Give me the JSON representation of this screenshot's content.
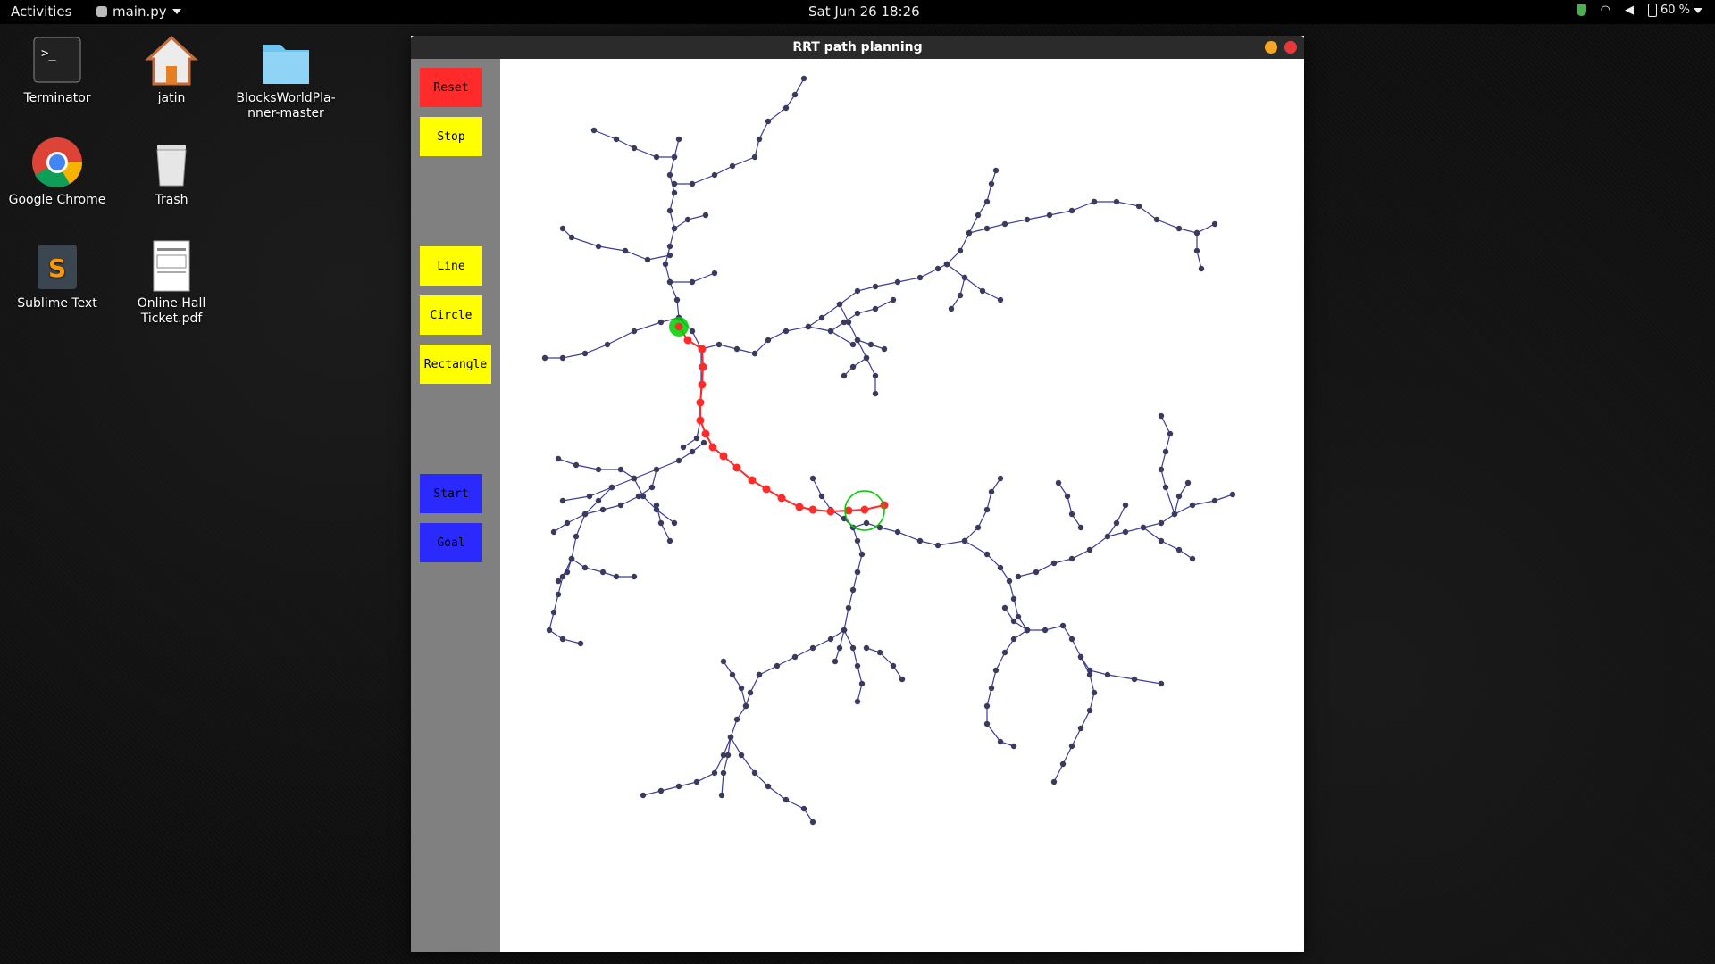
{
  "topbar": {
    "activities": "Activities",
    "app_menu": "main.py",
    "clock": "Sat Jun 26  18:26",
    "battery": "60 %"
  },
  "desktop": [
    {
      "label": "Terminator",
      "icon": "terminal-icon"
    },
    {
      "label": "jatin",
      "icon": "home-folder-icon"
    },
    {
      "label": "BlocksWorldPla-\nnner-master",
      "icon": "folder-icon"
    },
    {
      "label": "Google Chrome",
      "icon": "chrome-icon"
    },
    {
      "label": "Trash",
      "icon": "trash-icon"
    },
    {
      "label": "Sublime Text",
      "icon": "sublime-icon"
    },
    {
      "label": "Online Hall\nTicket.pdf",
      "icon": "pdf-icon"
    }
  ],
  "window": {
    "title": "RRT path planning",
    "buttons": {
      "reset": "Reset",
      "stop": "Stop",
      "line": "Line",
      "circle": "Circle",
      "rectangle": "Rectangle",
      "start": "Start",
      "goal": "Goal"
    }
  },
  "colors": {
    "tree": "#3a3a5a",
    "path": "#ff2a2a",
    "start": "#00cc00",
    "goal": "#00cc00"
  }
}
